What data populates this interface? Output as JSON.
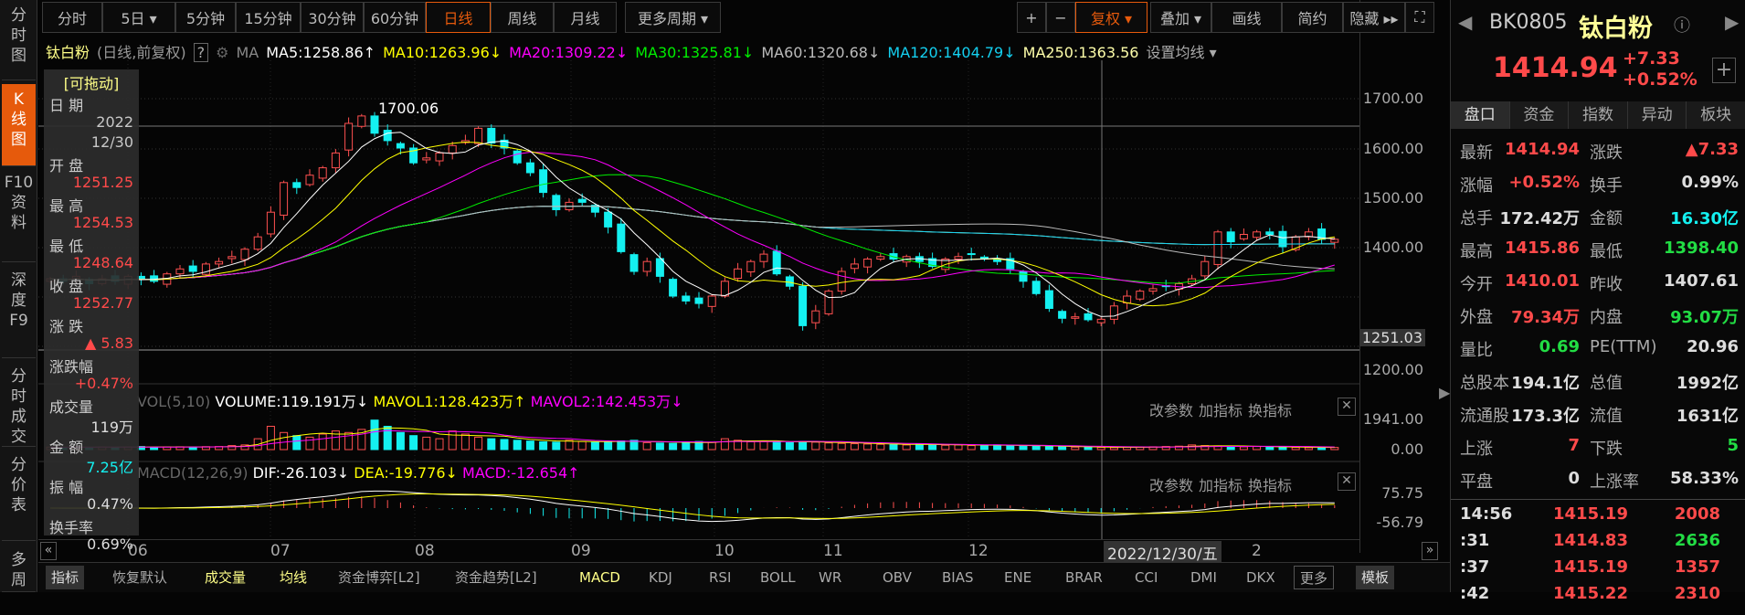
{
  "nav": [
    "分\n时\n图",
    "K\n线\n图",
    "F10\n资\n料",
    "深\n度\nF9",
    "分\n时\n成\n交",
    "分\n价\n表",
    "多\n周"
  ],
  "toolbar": {
    "periods": [
      "分时",
      "5日 ▾",
      "5分钟",
      "15分钟",
      "30分钟",
      "60分钟",
      "日线",
      "周线",
      "月线",
      "更多周期 ▾"
    ],
    "active": "日线",
    "zoom_in": "+",
    "zoom_out": "−",
    "fuquan": "复权 ▾",
    "overlay": "叠加 ▾",
    "draw": "画线",
    "simple": "简约",
    "hide": "隐藏 ▸▸",
    "fullscreen": "⛶"
  },
  "ma_line": {
    "name": "钛白粉",
    "mode": "(日线,前复权)",
    "help": "?",
    "ma": "MA",
    "ma5": "MA5:1258.86↑",
    "ma10": "MA10:1263.96↓",
    "ma20": "MA20:1309.22↓",
    "ma30": "MA30:1325.81↓",
    "ma60": "MA60:1320.68↓",
    "ma120": "MA120:1404.79↓",
    "ma250": "MA250:1363.56",
    "settings": "设置均线 ▾"
  },
  "colors": {
    "ma5": "#ffffff",
    "ma10": "#ffff00",
    "ma20": "#ff00ff",
    "ma30": "#00ee00",
    "ma60": "#bbbbbb",
    "ma120": "#14d0f0",
    "ma250": "#ffffaa",
    "up": "#ff5050",
    "down": "#14f0f0"
  },
  "price_axis": [
    "1700.00",
    "1600.00",
    "1500.00",
    "1400.00",
    "1251.03",
    "1200.00"
  ],
  "max_label": "1700.06",
  "vol_header": {
    "name": "VOL(5,10)",
    "volume": "VOLUME:119.191万↓",
    "mavol1": "MAVOL1:128.423万↑",
    "mavol2": "MAVOL2:142.453万↓",
    "axis": [
      "1941.00",
      "0.00"
    ]
  },
  "macd_header": {
    "name": "MACD(12,26,9)",
    "dif": "DIF:-26.103↓",
    "dea": "DEA:-19.776↓",
    "macd": "MACD:-12.654↑",
    "axis": [
      "75.75",
      "-56.79"
    ]
  },
  "panel_actions": [
    "改参数",
    "加指标",
    "换指标"
  ],
  "months": [
    "06",
    "07",
    "08",
    "09",
    "10",
    "11",
    "12",
    "2"
  ],
  "cursor_date": "2022/12/30/五",
  "info": {
    "drag": "[可拖动]",
    "date_l": "日 期",
    "year": "2022",
    "md": "12/30",
    "open_l": "开 盘",
    "open": "1251.25",
    "high_l": "最 高",
    "high": "1254.53",
    "low_l": "最 低",
    "low": "1248.64",
    "close_l": "收 盘",
    "close": "1252.77",
    "chg_l": "涨 跌",
    "chg": "▲ 5.83",
    "pct_l": "涨跌幅",
    "pct": "+0.47%",
    "vol_l": "成交量",
    "vol": "119万",
    "amt_l": "金 额",
    "amt": "7.25亿",
    "amp_l": "振 幅",
    "amp": "0.47%",
    "turn_l": "换手率",
    "turn": "0.69%"
  },
  "bottom": [
    "指标",
    "恢复默认",
    "成交量",
    "均线",
    "资金博弈[L2]",
    "资金趋势[L2]",
    "MACD",
    "KDJ",
    "RSI",
    "BOLL",
    "WR",
    "OBV",
    "BIAS",
    "ENE",
    "BRAR",
    "CCI",
    "DMI",
    "DKX",
    "更多",
    "模板"
  ],
  "right": {
    "code": "BK0805",
    "name": "钛白粉",
    "price": "1414.94",
    "chg": "+7.33",
    "pct": "+0.52%",
    "tabs": [
      "盘口",
      "资金",
      "指数",
      "异动",
      "板块"
    ],
    "rows": [
      [
        "最新",
        "1414.94",
        "red",
        "涨跌",
        "▲7.33",
        "red"
      ],
      [
        "涨幅",
        "+0.52%",
        "red",
        "换手",
        "0.99%",
        "wht"
      ],
      [
        "总手",
        "172.42万",
        "wht",
        "金额",
        "16.30亿",
        "cyn"
      ],
      [
        "最高",
        "1415.86",
        "red",
        "最低",
        "1398.40",
        "grn"
      ],
      [
        "今开",
        "1410.01",
        "red",
        "昨收",
        "1407.61",
        "wht"
      ],
      [
        "外盘",
        "79.34万",
        "red",
        "内盘",
        "93.07万",
        "grn"
      ],
      [
        "量比",
        "0.69",
        "grn",
        "PE(TTM)",
        "20.96",
        "wht"
      ],
      [
        "总股本",
        "194.1亿",
        "wht",
        "总值",
        "1992亿",
        "wht"
      ],
      [
        "流通股",
        "173.3亿",
        "wht",
        "流值",
        "1631亿",
        "wht"
      ],
      [
        "上涨",
        "7",
        "red",
        "下跌",
        "5",
        "grn"
      ],
      [
        "平盘",
        "0",
        "wht",
        "上涨率",
        "58.33%",
        "wht"
      ]
    ],
    "ticks": [
      [
        "14:56",
        "1415.19",
        "2008",
        "red"
      ],
      [
        ":31",
        "1414.83",
        "2636",
        "grn"
      ],
      [
        ":37",
        "1415.19",
        "1357",
        "red"
      ],
      [
        ":42",
        "1415.22",
        "2310",
        "red"
      ]
    ]
  },
  "chart_data": {
    "type": "candlestick",
    "ylim": [
      1150,
      1750
    ],
    "closes": [
      1335,
      1330,
      1340,
      1325,
      1335,
      1330,
      1340,
      1335,
      1330,
      1345,
      1355,
      1350,
      1365,
      1370,
      1380,
      1395,
      1420,
      1470,
      1530,
      1520,
      1545,
      1560,
      1590,
      1650,
      1665,
      1630,
      1615,
      1600,
      1570,
      1580,
      1590,
      1605,
      1615,
      1640,
      1610,
      1600,
      1570,
      1550,
      1510,
      1475,
      1490,
      1490,
      1470,
      1440,
      1390,
      1350,
      1370,
      1340,
      1300,
      1290,
      1285,
      1300,
      1330,
      1355,
      1370,
      1385,
      1345,
      1320,
      1240,
      1270,
      1310,
      1350,
      1365,
      1375,
      1380,
      1375,
      1380,
      1370,
      1360,
      1375,
      1380,
      1385,
      1375,
      1370,
      1355,
      1330,
      1305,
      1275,
      1255,
      1258,
      1252,
      1253,
      1280,
      1300,
      1310,
      1315,
      1320,
      1325,
      1335,
      1370,
      1430,
      1410,
      1425,
      1430,
      1425,
      1400,
      1420,
      1430,
      1415,
      1415
    ],
    "volumes": [
      160,
      150,
      180,
      140,
      170,
      150,
      160,
      200,
      150,
      170,
      180,
      160,
      190,
      200,
      260,
      300,
      700,
      1500,
      1100,
      900,
      800,
      1000,
      1200,
      1100,
      1300,
      1900,
      1500,
      1100,
      900,
      800,
      700,
      1200,
      1000,
      800,
      700,
      650,
      600,
      550,
      500,
      480,
      600,
      520,
      480,
      500,
      560,
      600,
      450,
      420,
      400,
      480,
      520,
      460,
      700,
      600,
      500,
      560,
      480,
      450,
      520,
      480,
      430,
      400,
      380,
      360,
      340,
      320,
      300,
      380,
      300,
      280,
      300,
      260,
      280,
      300,
      250,
      240,
      220,
      200,
      180,
      160,
      150,
      140,
      130,
      150,
      160,
      180,
      200,
      220,
      300,
      260,
      240,
      200,
      180,
      200,
      160,
      150,
      140,
      130,
      150,
      140
    ]
  }
}
